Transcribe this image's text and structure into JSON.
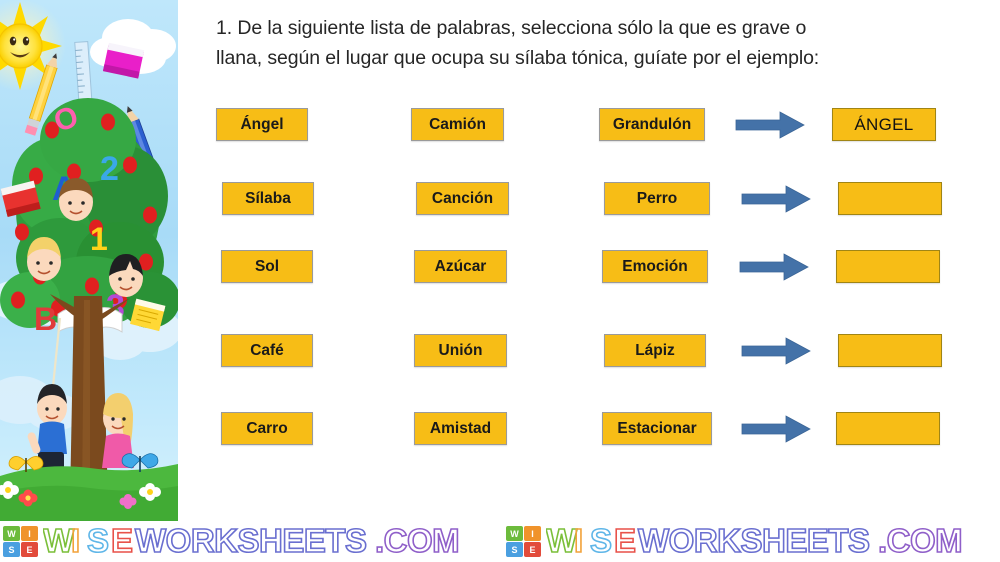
{
  "instruction": {
    "line1": "1. De la siguiente lista de palabras, selecciona sólo la que es grave o",
    "line2": "llana, según el lugar que ocupa su sílaba tónica, guíate por el ejemplo:"
  },
  "colors": {
    "word_box_fill": "#F7BD16",
    "word_box_border": "#9A9A9A",
    "answer_box_border": "#A08515",
    "arrow": "#4472A8",
    "text": "#262626",
    "sky": "#A9DCF7",
    "tree": "#2E9B3C",
    "trunk": "#7B4A1E"
  },
  "rows": [
    {
      "col1": "Ángel",
      "col2": "Camión",
      "col3": "Grandulón",
      "arrow": "arrow-right-icon",
      "answer": "ÁNGEL"
    },
    {
      "col1": "Sílaba",
      "col2": "Canción",
      "col3": "Perro",
      "arrow": "arrow-right-icon",
      "answer": ""
    },
    {
      "col1": "Sol",
      "col2": "Azúcar",
      "col3": "Emoción",
      "arrow": "arrow-right-icon",
      "answer": ""
    },
    {
      "col1": "Café",
      "col2": "Unión",
      "col3": "Lápiz",
      "arrow": "arrow-right-icon",
      "answer": ""
    },
    {
      "col1": "Carro",
      "col2": "Amistad",
      "col3": "Estacionar",
      "arrow": "arrow-right-icon",
      "answer": ""
    }
  ],
  "illustration": {
    "alt": "school tree with children, sun, clouds, books, pencils, letters and numbers"
  },
  "watermark": {
    "logo_letters": [
      "W",
      "I",
      "S",
      "E"
    ],
    "text": "WISEWORKSHEETS.COM",
    "instances": 2
  }
}
